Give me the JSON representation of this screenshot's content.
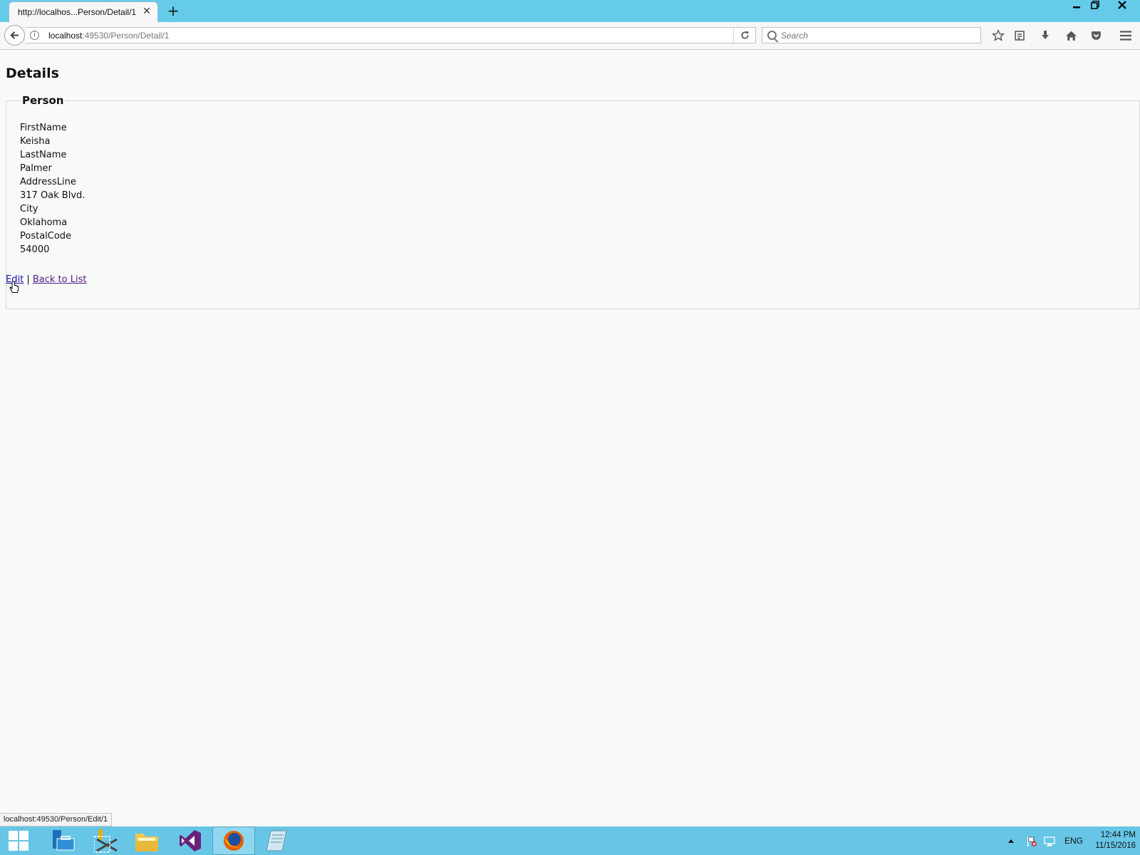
{
  "browser": {
    "tab_title": "http://localhos...Person/Detail/1",
    "tab_close": "✕",
    "new_tab": "+",
    "url_host": "localhost",
    "url_rest": ":49530/Person/Detail/1",
    "search_placeholder": "Search"
  },
  "page": {
    "title": "Details",
    "legend": "Person",
    "fields": [
      {
        "label": "FirstName",
        "value": "Keisha"
      },
      {
        "label": "LastName",
        "value": "Palmer"
      },
      {
        "label": "AddressLine",
        "value": "317 Oak Blvd."
      },
      {
        "label": "City",
        "value": "Oklahoma"
      },
      {
        "label": "PostalCode",
        "value": "54000"
      }
    ],
    "edit_link": "Edit",
    "separator": "|",
    "back_link": "Back to List"
  },
  "status_bar": {
    "text": "localhost:49530/Person/Edit/1"
  },
  "taskbar": {
    "language": "ENG",
    "time": "12:44 PM",
    "date": "11/15/2016"
  },
  "icons": {
    "back": "arrow-left-icon",
    "info": "info-icon",
    "reload": "reload-icon",
    "search": "search-icon",
    "bookmark_star": "star-icon",
    "reading_list": "reading-list-icon",
    "downloads": "download-icon",
    "home": "home-icon",
    "pocket": "pocket-icon",
    "menu": "hamburger-menu-icon"
  },
  "colors": {
    "titlebar": "#65cbe9",
    "taskbar": "#67c6e6",
    "page_background": "#f8faf8",
    "link_visited": "#551a8b",
    "link": "#1a0dab"
  }
}
